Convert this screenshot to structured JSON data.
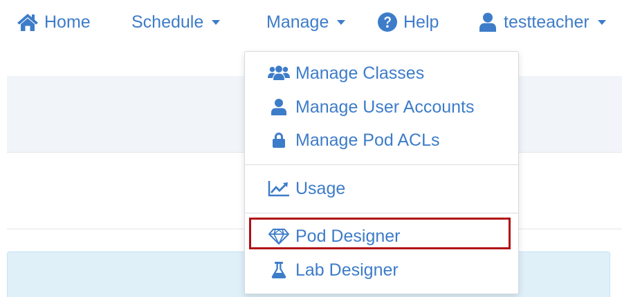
{
  "navbar": {
    "home": {
      "label": "Home",
      "icon": "home-icon"
    },
    "schedule": {
      "label": "Schedule",
      "icon": "chevron-down-icon"
    },
    "manage": {
      "label": "Manage",
      "icon": "chevron-down-icon"
    },
    "help": {
      "label": "Help",
      "icon": "question-circle-icon"
    },
    "user": {
      "label": "testteacher",
      "icon": "user-icon"
    }
  },
  "manage_menu": {
    "items": [
      {
        "label": "Manage Classes",
        "icon": "users-icon"
      },
      {
        "label": "Manage User Accounts",
        "icon": "user-icon"
      },
      {
        "label": "Manage Pod ACLs",
        "icon": "lock-icon"
      },
      {
        "label": "Usage",
        "icon": "line-chart-icon"
      },
      {
        "label": "Pod Designer",
        "icon": "diamond-icon"
      },
      {
        "label": "Lab Designer",
        "icon": "flask-icon"
      }
    ],
    "highlighted_item": "Pod Designer"
  },
  "colors": {
    "link": "#3d7cc9",
    "highlight_border": "#b00e14",
    "panel_grey": "#f1f5f9",
    "info_panel": "#dff0f9"
  }
}
